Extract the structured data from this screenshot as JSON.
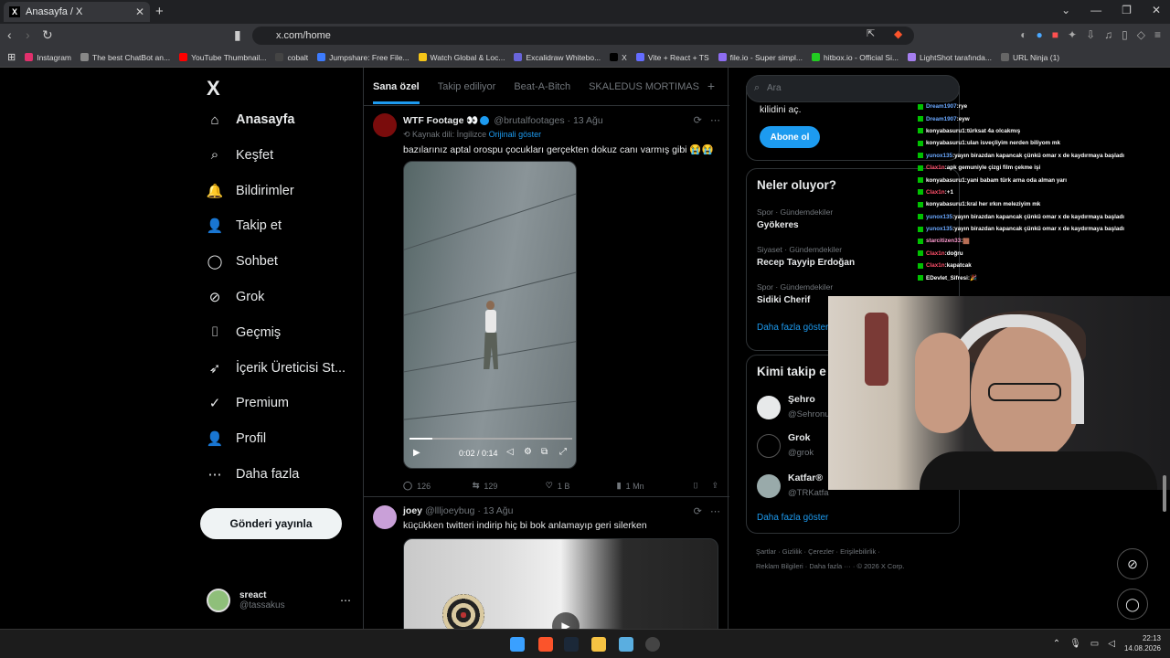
{
  "browser": {
    "tab_title": "Anasayfa / X",
    "url": "x.com/home",
    "bookmarks": [
      "Instagram",
      "The best ChatBot an...",
      "YouTube Thumbnail...",
      "cobalt",
      "Jumpshare: Free File...",
      "Watch Global & Loc...",
      "Excalidraw Whitebo...",
      "X",
      "Vite + React + TS",
      "file.io - Super simpl...",
      "hitbox.io - Official Si...",
      "LightShot tarafında...",
      "URL Ninja (1)"
    ]
  },
  "sidebar": {
    "logo": "X",
    "items": [
      {
        "label": "Anasayfa",
        "icon": "home-icon",
        "glyph": "⌂"
      },
      {
        "label": "Keşfet",
        "icon": "search-icon",
        "glyph": "⌕"
      },
      {
        "label": "Bildirimler",
        "icon": "bell-icon",
        "glyph": "🔔"
      },
      {
        "label": "Takip et",
        "icon": "add-user-icon",
        "glyph": "👤"
      },
      {
        "label": "Sohbet",
        "icon": "chat-icon",
        "glyph": "◯"
      },
      {
        "label": "Grok",
        "icon": "grok-icon",
        "glyph": "⊘"
      },
      {
        "label": "Geçmiş",
        "icon": "bookmark-icon",
        "glyph": "⌷"
      },
      {
        "label": "İçerik Üreticisi St...",
        "icon": "rocket-icon",
        "glyph": "➶"
      },
      {
        "label": "Premium",
        "icon": "verified-icon",
        "glyph": "✓"
      },
      {
        "label": "Profil",
        "icon": "profile-icon",
        "glyph": "👤"
      },
      {
        "label": "Daha fazla",
        "icon": "more-icon",
        "glyph": "⋯"
      }
    ],
    "post_button": "Gönderi yayınla",
    "account": {
      "name": "sreact",
      "handle": "@tassakus"
    }
  },
  "feed": {
    "tabs": [
      "Sana özel",
      "Takip ediliyor",
      "Beat-A-Bitch",
      "SKALEDUS MORTIMAS"
    ],
    "tweets": [
      {
        "author": "WTF Footage 👀",
        "handle": "@brutalfootages",
        "time": "13 Ağu",
        "source": "Kaynak dili: İngilizce",
        "show_original": "Orijinali göster",
        "text": "bazılarınız aptal orospu çocukları gerçekten dokuz canı varmış gibi 😭😭",
        "video_time": "0:02 / 0:14",
        "video_progress": 0.14,
        "replies": "126",
        "reposts": "129",
        "likes": "1 B",
        "views": "1 Mn"
      },
      {
        "author": "joey",
        "handle": "@llljoeybug",
        "time": "13 Ağu",
        "text": "küçükken twitteri indirip hiç bi bok anlamayıp geri silerken"
      }
    ]
  },
  "right": {
    "search_placeholder": "Ara",
    "premium_text": "kilidini aç.",
    "subscribe": "Abone ol",
    "happening_title": "Neler oluyor?",
    "trends": [
      {
        "context": "Spor · Gündemdekiler",
        "name": "Gyökeres"
      },
      {
        "context": "Siyaset · Gündemdekiler",
        "name": "Recep Tayyip Erdoğan"
      },
      {
        "context": "Spor · Gündemdekiler",
        "name": "Sidiki Cherif"
      }
    ],
    "show_more": "Daha fazla göster",
    "who_title": "Kimi takip e",
    "who": [
      {
        "name": "Şehro",
        "handle": "@Sehronu"
      },
      {
        "name": "Grok",
        "handle": "@grok"
      },
      {
        "name": "Katfar®",
        "handle": "@TRKatfa"
      }
    ],
    "who_more": "Daha fazla göster",
    "footer": [
      "Şartlar",
      "Gizlilik",
      "Çerezler",
      "Erişilebilirlik",
      "Reklam Bilgileri",
      "Daha fazla ···",
      "© 2026 X Corp."
    ]
  },
  "chat": [
    {
      "user": "Dream1907",
      "msg": "rye",
      "color": "#6aa8ff"
    },
    {
      "user": "Dream1907",
      "msg": "eyw",
      "color": "#6aa8ff"
    },
    {
      "user": "konyabasuru1",
      "msg": "türksat 4a olcakmış",
      "color": "#ffffff"
    },
    {
      "user": "konyabasuru1",
      "msg": "ulan isveçliyim nerden biliyom mk",
      "color": "#ffffff"
    },
    {
      "user": "yunox135",
      "msg": "yayın birazdan kapancak çünkü omar x de kaydırmaya başladı",
      "color": "#6aa8ff"
    },
    {
      "user": "Clax1n",
      "msg": "apk gemuniyle çizgi film çekme işi",
      "color": "#ff4f6a"
    },
    {
      "user": "konyabasuru1",
      "msg": "yani babam türk arna oda alman yarı",
      "color": "#ffffff"
    },
    {
      "user": "Clax1n",
      "msg": "+1",
      "color": "#ff4f6a"
    },
    {
      "user": "konyabasuru1",
      "msg": "kral her ırkın meleziyim mk",
      "color": "#ffffff"
    },
    {
      "user": "yunox135",
      "msg": "yayın birazdan kapancak çünkü omar x de kaydırmaya başladı",
      "color": "#6aa8ff"
    },
    {
      "user": "yunox135",
      "msg": "yayın birazdan kapancak çünkü omar x de kaydırmaya başladı",
      "color": "#6aa8ff"
    },
    {
      "user": "starcitizen33",
      "msg": "🟫",
      "color": "#ff9bd0"
    },
    {
      "user": "Clax1n",
      "msg": "doğru",
      "color": "#ff4f6a"
    },
    {
      "user": "Clax1n",
      "msg": "kapatcak",
      "color": "#ff4f6a"
    },
    {
      "user": "EDevlet_Sifresi",
      "msg": "🎉",
      "color": "#ffffff"
    }
  ],
  "taskbar": {
    "time": "22:13",
    "date": "14.08.2026"
  }
}
